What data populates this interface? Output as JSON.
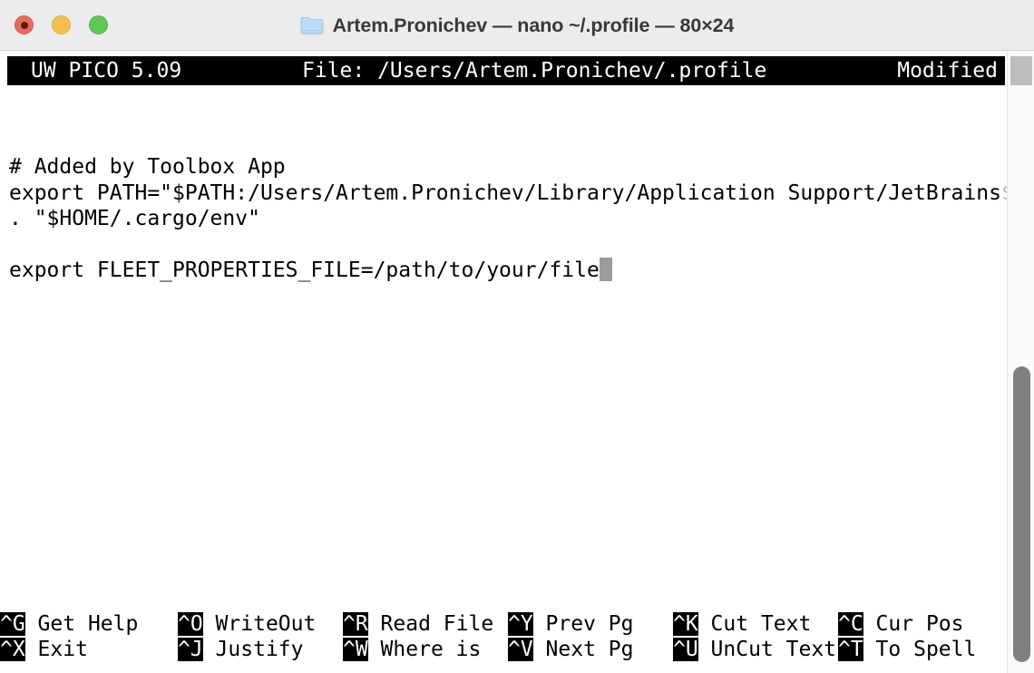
{
  "window": {
    "title": "Artem.Pronichev — nano ~/.profile — 80×24",
    "folder_icon": "folder-icon",
    "traffic_lights": [
      {
        "name": "close-button",
        "color": "#e8695f",
        "label": "Close"
      },
      {
        "name": "minimize-button",
        "color": "#f3bf4f",
        "label": "Minimize"
      },
      {
        "name": "maximize-button",
        "color": "#5fc854",
        "label": "Maximize"
      }
    ]
  },
  "nano": {
    "header": {
      "version": "UW PICO 5.09",
      "file": "File: /Users/Artem.Pronichev/.profile",
      "state": "Modified"
    },
    "editor": {
      "lines": [
        "",
        "",
        "# Added by Toolbox App",
        "export PATH=\"$PATH:/Users/Artem.Pronichev/Library/Application Support/JetBrains",
        ". \"$HOME/.cargo/env\"",
        "",
        "export FLEET_PROPERTIES_FILE=/path/to/your/file"
      ],
      "continuation_marker": "$",
      "cursor_line_index": 6,
      "cursor_column": 47
    },
    "shortcuts": {
      "row1": [
        {
          "key": "^G",
          "label": " Get Help"
        },
        {
          "key": "^O",
          "label": " WriteOut"
        },
        {
          "key": "^R",
          "label": " Read File"
        },
        {
          "key": "^Y",
          "label": " Prev Pg"
        },
        {
          "key": "^K",
          "label": " Cut Text"
        },
        {
          "key": "^C",
          "label": " Cur Pos"
        }
      ],
      "row2": [
        {
          "key": "^X",
          "label": " Exit"
        },
        {
          "key": "^J",
          "label": " Justify"
        },
        {
          "key": "^W",
          "label": " Where is"
        },
        {
          "key": "^V",
          "label": " Next Pg"
        },
        {
          "key": "^U",
          "label": " UnCut Text"
        },
        {
          "key": "^T",
          "label": " To Spell"
        }
      ]
    }
  },
  "scrollbar": {
    "name": "vertical-scrollbar",
    "thumb_color": "#808080",
    "track_color": "#fafafa"
  },
  "colors": {
    "titlebar_bg": "#ececec",
    "terminal_bg": "#ffffff",
    "terminal_fg": "#000000",
    "reverse_bg": "#000000",
    "reverse_fg": "#ffffff",
    "cursor": "#9b9b9b",
    "continuation": "#b9b9b9"
  }
}
